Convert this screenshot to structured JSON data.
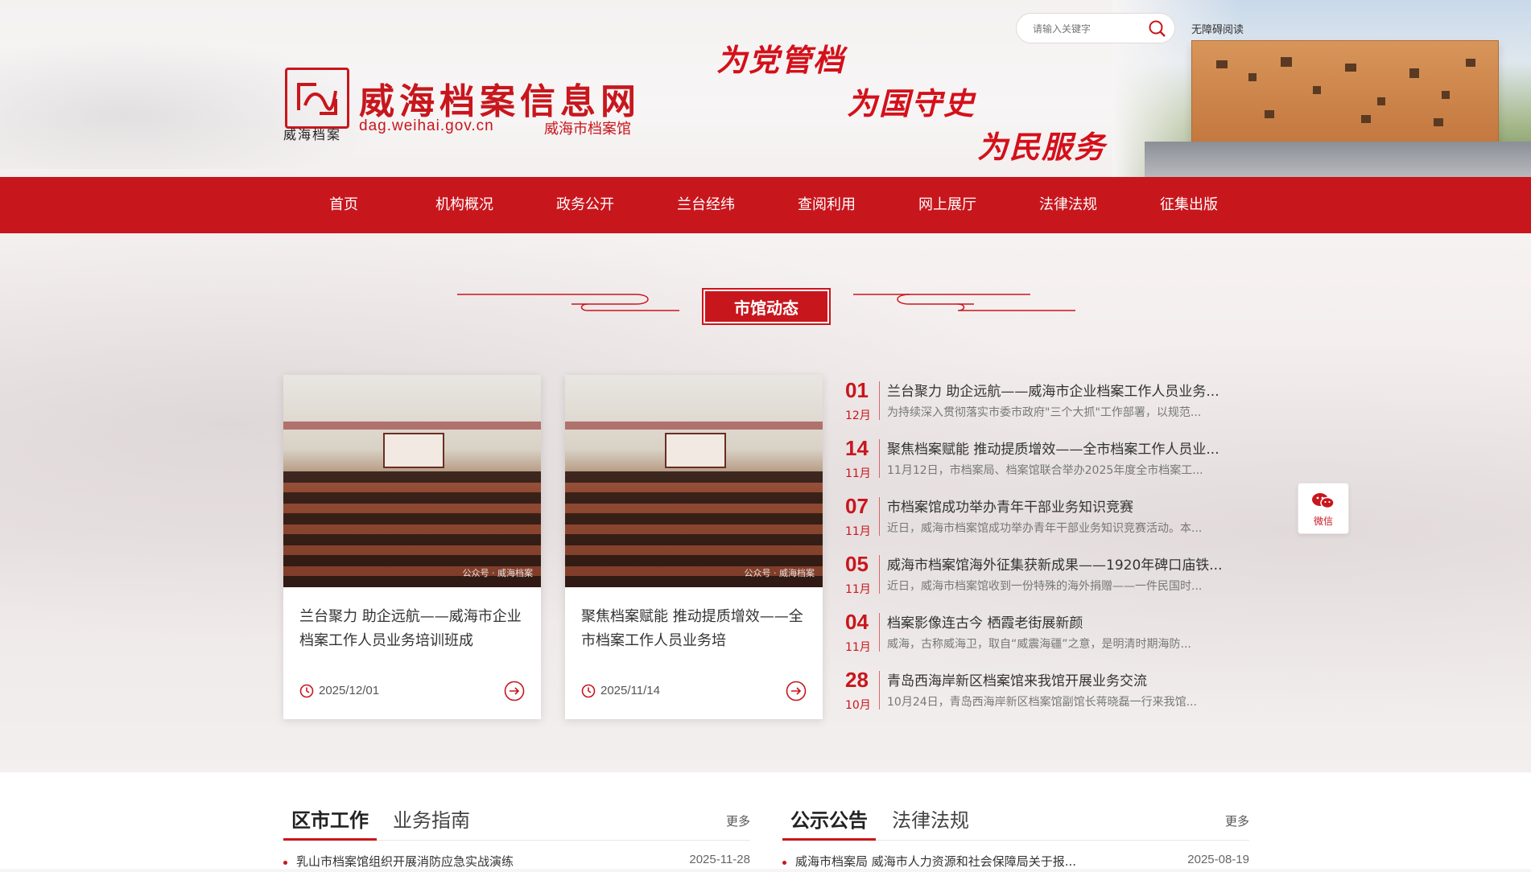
{
  "header": {
    "site_title": "威海档案信息网",
    "site_domain": "dag.weihai.gov.cn",
    "site_org": "威海市档案馆",
    "logo_text": "威海档案",
    "slogans": [
      "为党管档",
      "为国守史",
      "为民服务"
    ],
    "search_placeholder": "请输入关键字",
    "accessible_label": "无障碍阅读"
  },
  "nav": {
    "items": [
      "首页",
      "机构概况",
      "政务公开",
      "兰台经纬",
      "查阅利用",
      "网上展厅",
      "法律法规",
      "征集出版"
    ]
  },
  "section": {
    "title": "市馆动态"
  },
  "cards": [
    {
      "title": "兰台聚力 助企远航——威海市企业档案工作人员业务培训班成",
      "date": "2025/12/01",
      "watermark": "公众号 · 威海档案"
    },
    {
      "title": "聚焦档案赋能 推动提质增效——全市档案工作人员业务培",
      "date": "2025/11/14",
      "watermark": "公众号 · 威海档案"
    }
  ],
  "news": [
    {
      "day": "01",
      "month": "12月",
      "title": "兰台聚力 助企远航——威海市企业档案工作人员业务...",
      "summary": "为持续深入贯彻落实市委市政府\"三个大抓\"工作部署，以规范..."
    },
    {
      "day": "14",
      "month": "11月",
      "title": "聚焦档案赋能 推动提质增效——全市档案工作人员业...",
      "summary": "11月12日，市档案局、档案馆联合举办2025年度全市档案工..."
    },
    {
      "day": "07",
      "month": "11月",
      "title": "市档案馆成功举办青年干部业务知识竞赛",
      "summary": "近日，威海市档案馆成功举办青年干部业务知识竞赛活动。本..."
    },
    {
      "day": "05",
      "month": "11月",
      "title": "威海市档案馆海外征集获新成果——1920年碑口庙铁...",
      "summary": "近日，威海市档案馆收到一份特殊的海外捐赠——一件民国时..."
    },
    {
      "day": "04",
      "month": "11月",
      "title": "档案影像连古今 栖霞老街展新颜",
      "summary": "威海，古称威海卫，取自“威震海疆”之意，是明清时期海防..."
    },
    {
      "day": "28",
      "month": "10月",
      "title": "青岛西海岸新区档案馆来我馆开展业务交流",
      "summary": "10月24日，青岛西海岸新区档案馆副馆长蒋晓磊一行来我馆..."
    }
  ],
  "wechat": {
    "label": "微信"
  },
  "bottom": {
    "left": {
      "tabs": [
        "区市工作",
        "业务指南"
      ],
      "more": "更多",
      "row": {
        "title": "乳山市档案馆组织开展消防应急实战演练",
        "date": "2025-11-28"
      }
    },
    "right": {
      "tabs": [
        "公示公告",
        "法律法规"
      ],
      "more": "更多",
      "row": {
        "title": "威海市档案局 威海市人力资源和社会保障局关于报...",
        "date": "2025-08-19"
      }
    }
  },
  "colors": {
    "brand_red": "#c8161d"
  },
  "icons": {
    "search": "search-icon",
    "clock": "clock-icon",
    "arrow": "arrow-right-circle-icon",
    "wechat": "wechat-icon"
  }
}
